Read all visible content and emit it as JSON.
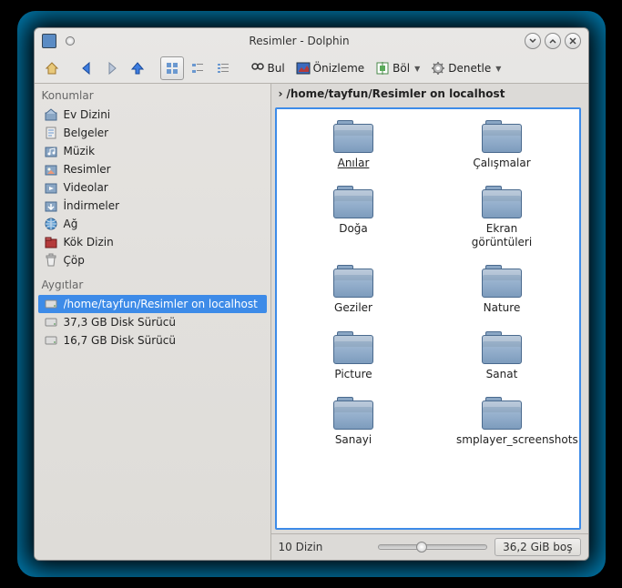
{
  "window": {
    "title": "Resimler - Dolphin"
  },
  "toolbar": {
    "find": "Bul",
    "preview": "Önizleme",
    "split": "Böl",
    "control": "Denetle"
  },
  "sidebar": {
    "places_header": "Konumlar",
    "devices_header": "Aygıtlar",
    "places": [
      {
        "label": "Ev Dizini",
        "icon": "folder-home"
      },
      {
        "label": "Belgeler",
        "icon": "folder-documents"
      },
      {
        "label": "Müzik",
        "icon": "folder-music"
      },
      {
        "label": "Resimler",
        "icon": "folder-pictures"
      },
      {
        "label": "Videolar",
        "icon": "folder-videos"
      },
      {
        "label": "İndirmeler",
        "icon": "folder-downloads"
      },
      {
        "label": "Ağ",
        "icon": "globe"
      },
      {
        "label": "Kök Dizin",
        "icon": "folder-root"
      },
      {
        "label": "Çöp",
        "icon": "trash"
      }
    ],
    "devices": [
      {
        "label": "/home/tayfun/Resimler on localhost",
        "icon": "drive",
        "selected": true
      },
      {
        "label": "37,3 GB Disk Sürücü",
        "icon": "drive"
      },
      {
        "label": "16,7 GB Disk Sürücü",
        "icon": "drive"
      }
    ]
  },
  "breadcrumb": "/home/tayfun/Resimler on localhost",
  "folders": [
    {
      "label": "Anılar",
      "selected": true
    },
    {
      "label": "Çalışmalar"
    },
    {
      "label": "Doğa"
    },
    {
      "label": "Ekran görüntüleri"
    },
    {
      "label": "Geziler"
    },
    {
      "label": "Nature"
    },
    {
      "label": "Picture"
    },
    {
      "label": "Sanat"
    },
    {
      "label": "Sanayi"
    },
    {
      "label": "smplayer_screenshots"
    }
  ],
  "status": {
    "count": "10 Dizin",
    "free": "36,2 GiB boş"
  }
}
